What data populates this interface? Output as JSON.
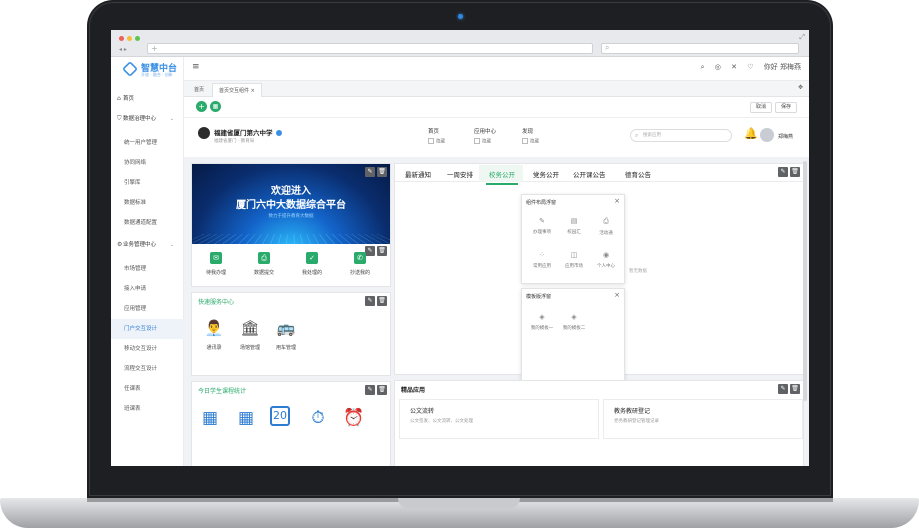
{
  "browser": {
    "url_plus": "+",
    "search_glyph": "⌕",
    "back_forward": "◂ ▸",
    "expand": "⤢"
  },
  "sidebar": {
    "logo_title": "智慧中台",
    "logo_sub": "开放 · 融合 · 创新",
    "items": [
      {
        "label": "首页",
        "icon": "home-icon",
        "group": true
      },
      {
        "label": "数据治理中心",
        "icon": "shield-icon",
        "group": true,
        "chevron": "⌄"
      },
      {
        "label": "统一用户管理"
      },
      {
        "label": "协同网络"
      },
      {
        "label": "引擎库"
      },
      {
        "label": "数据标准"
      },
      {
        "label": "数据通道配置"
      },
      {
        "label": "业务管理中心",
        "icon": "gear-icon",
        "group": true,
        "chevron": "⌄"
      },
      {
        "label": "市场管理"
      },
      {
        "label": "接入申请"
      },
      {
        "label": "应用管理"
      },
      {
        "label": "门户交互设计",
        "active": true
      },
      {
        "label": "移动交互设计"
      },
      {
        "label": "流程交互设计"
      },
      {
        "label": "任课表"
      },
      {
        "label": "班课表"
      }
    ]
  },
  "topbar": {
    "menu_glyph": "≡",
    "icons": [
      "⌕",
      "◎",
      "✕",
      "♡"
    ],
    "user": "你好 郑梅燕"
  },
  "tabs": {
    "home": "首页",
    "current": "首页交互组件",
    "close": "×",
    "menu": "✥"
  },
  "editbar": {
    "add": "+",
    "layout": "▦",
    "cancel": "取消",
    "save": "保存"
  },
  "header": {
    "school_name": "福建省厦门第六中学",
    "school_sub": "福建省厦门 · 教育局",
    "nav": [
      {
        "label": "首页",
        "sub": "隐藏"
      },
      {
        "label": "应用中心",
        "sub": "隐藏"
      },
      {
        "label": "发现",
        "sub": "隐藏"
      }
    ],
    "search_placeholder": "搜索应用",
    "bell": "🔔",
    "user": "郑梅燕"
  },
  "card_tools": {
    "edit": "✎",
    "delete": "🗑"
  },
  "banner": {
    "line1": "欢迎进入",
    "line2": "厦门六中大数据综合平台",
    "line3": "致力于提升教育大数据"
  },
  "quick_items": [
    {
      "label": "待我办理",
      "icon": "✉"
    },
    {
      "label": "数据提交",
      "icon": "⎙"
    },
    {
      "label": "我处理的",
      "icon": "✓"
    },
    {
      "label": "抄送我的",
      "icon": "✆"
    }
  ],
  "services": {
    "title": "快速服务中心",
    "items": [
      {
        "label": "通讯录",
        "icon": "👨‍💼"
      },
      {
        "label": "场馆管理",
        "icon": "🏛"
      },
      {
        "label": "用车管理",
        "icon": "🚌"
      }
    ]
  },
  "stats": {
    "title": "今日学生课程统计",
    "icons": [
      "▦",
      "▦",
      "20",
      "⏱",
      "⏰"
    ]
  },
  "news": {
    "tabs": [
      "最新通知",
      "一周安排",
      "校务公开",
      "党务公开",
      "公开课公告",
      "德育公告"
    ],
    "active_index": 2,
    "empty": "暂无数据"
  },
  "panel1": {
    "title": "组件布局浮窗",
    "close": "×",
    "items": [
      {
        "label": "办理事项",
        "icon": "✎"
      },
      {
        "label": "校园汇",
        "icon": "▤"
      },
      {
        "label": "活动通",
        "icon": "⎙"
      },
      {
        "label": "常用应用",
        "icon": "⁘"
      },
      {
        "label": "应用市场",
        "icon": "◫"
      },
      {
        "label": "个人中心",
        "icon": "◉"
      }
    ]
  },
  "panel2": {
    "title": "模板版浮窗",
    "close": "×",
    "items": [
      {
        "label": "我的模板一",
        "icon": "◈"
      },
      {
        "label": "我的模板二",
        "icon": "◈"
      }
    ]
  },
  "featured": {
    "title": "精品应用",
    "cards": [
      {
        "title": "公文流转",
        "sub": "公文签发、公文流转、公文处理"
      },
      {
        "title": "教务教研登记",
        "sub": "党务教研登记管理记录"
      }
    ]
  },
  "colors": {
    "accent": "#2aaa6b",
    "brand": "#3b8fe4"
  }
}
